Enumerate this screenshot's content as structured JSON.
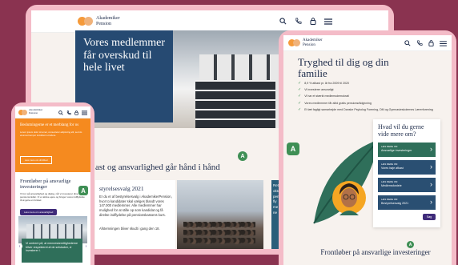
{
  "logo": {
    "line1": "Akademiker",
    "line2": "Pension"
  },
  "icons": [
    "search-icon",
    "phone-icon",
    "lock-icon",
    "menu-icon"
  ],
  "accessibility_badge": "A",
  "left_device": {
    "hero_title": "Vores medlemmer får overskud til hele livet",
    "section_title": "ast og ansvarlighed går hånd i hånd",
    "card_title": "styrelsesvalg 2021",
    "card_text": "Er du et af bestyrelsesvalg i AkademikerPension, hvor to kandidater skal vælges blandt vores 147.000 medlemmer. Alle medlemmer har mulighed for at stille op som kandidat og få direkte indflydelse på pensionskassens kurs.",
    "card_text2": "Afstemningen bliver skudt i gang den 18.",
    "side_snippet": [
      "Retu",
      "oktob",
      "pens",
      "fly",
      "me",
      "ne"
    ]
  },
  "phone": {
    "orange_title": "Beslutningerne er et merblang for os",
    "orange_text": "Lorem ipsum dolor sit amet, consectetur adipiscing elit, sed do eiusmod tempor incididunt ut labore.",
    "orange_button": "Læs mere om dit tilbud",
    "section_title": "Frontløber på ansvarlige investeringer",
    "section_text": "Vi tror på ansvarlighed og dialog, når vi investerer dine pensionsmidler. Vi er aktive ejere og bruger vores indflydelse til at gøre en forskel.",
    "section_button": "Læs mere om ansvarlighed",
    "green_card_text": "Vi omtrent på, at menneskerettighederne bliver respekteret af de selskaber, vi investerer i."
  },
  "right_device": {
    "title": "Tryghed til dig og din familie",
    "checklist": [
      "8,9 % afkast pr. år fra 2009 til 2020",
      "Vi investerer ansvarligt",
      "Vi har et stærkt medlemsdemokrati",
      "Vores medlemmer får altid gratis pensionsrådgivning",
      "Et tæt fagligt samarbejde med Danske Psykolog Forening, DM og Gymnasieskolernes Lærerforening"
    ],
    "panel_title": "Hvad vil du gerne vide mere om?",
    "panel_items": [
      {
        "kicker": "Læs mere om",
        "label": "Ansvarlige investeringer"
      },
      {
        "kicker": "Læs mere om",
        "label": "Vores høje afkast"
      },
      {
        "kicker": "Læs mere om",
        "label": "Medlemsfordele"
      },
      {
        "kicker": "Læs mere om",
        "label": "Bestyrelsesvalg 2021"
      }
    ],
    "panel_button": "Søg",
    "bottom_title": "Frontløber på ansvarlige investeringer"
  },
  "colors": {
    "navy": "#1d2b4a",
    "orange": "#f58a1f",
    "green": "#2f6f5a",
    "purple": "#3f2b7a",
    "background": "#8a3350",
    "device": "#f4bcc8"
  }
}
